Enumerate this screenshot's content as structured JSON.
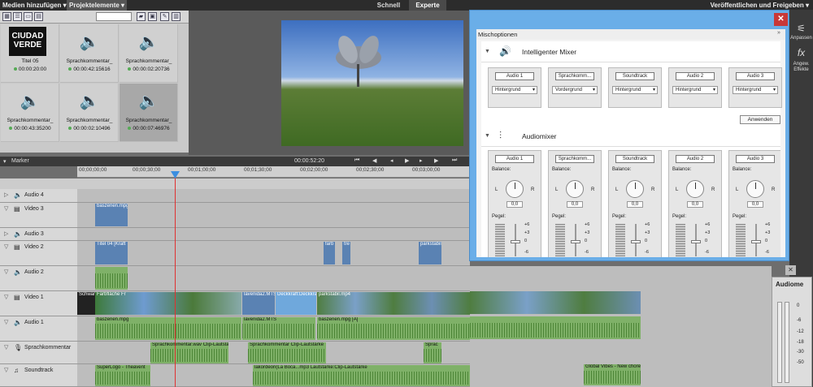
{
  "menu": {
    "media_add": "Medien hinzufügen ▾",
    "project_elements": "Projektelemente ▾",
    "mode_quick": "Schnell",
    "mode_expert": "Experte",
    "publish": "Veröffentlichen und Freigeben ▾"
  },
  "media_items": [
    {
      "name": "Titel 05",
      "duration": "00:00:20:00",
      "logo_line1": "CIUDAD",
      "logo_line2": "VERDE"
    },
    {
      "name": "Sprachkommentar_",
      "duration": "00:00:42:15616"
    },
    {
      "name": "Sprachkommentar_",
      "duration": "00:00:02:20736"
    },
    {
      "name": "Sprachkommentar_",
      "duration": "00:00:43:35200"
    },
    {
      "name": "Sprachkommentar_",
      "duration": "00:00:02:10496"
    },
    {
      "name": "Sprachkommentar_",
      "duration": "00:00:07:46976"
    }
  ],
  "timeline": {
    "marker_label": "Marker",
    "current_time": "00:00:52:20",
    "ruler_ticks": [
      "00;00;00;00",
      "00;00;30;00",
      "00;01;00;00",
      "00;01;30;00",
      "00;02;00;00",
      "00;02;30;00",
      "00;03;00;00"
    ],
    "tracks": [
      {
        "name": "Audio 4",
        "icon": "speaker-icon"
      },
      {
        "name": "Video 3",
        "icon": "film-icon"
      },
      {
        "name": "Audio 3",
        "icon": "speaker-icon"
      },
      {
        "name": "Video 2",
        "icon": "film-icon"
      },
      {
        "name": "Audio 2",
        "icon": "speaker-icon"
      },
      {
        "name": "Video 1",
        "icon": "film-icon"
      },
      {
        "name": "Audio 1",
        "icon": "speaker-icon"
      },
      {
        "name": "Sprachkommentar",
        "icon": "microphone-icon"
      },
      {
        "name": "Soundtrack",
        "icon": "music-icon"
      }
    ],
    "clips": {
      "video3": "baszenen.mpg",
      "video2_a": "Titel 04 [Kraft",
      "video2_b": "farb",
      "video2_c": "tre",
      "video2_d": "parkstabil",
      "video1_a": "Schwarz",
      "video1_b": "Farbfläche Fr",
      "video1_c": "lavenida2.MTS",
      "video1_d": "Deckkraft:Deckkraft",
      "video1_e": "parkstabil.mp4",
      "audio1_a": "baszenen.mpg",
      "audio1_b": "lavenida2.MTS",
      "audio1_c": "baszenen.mpg [A]",
      "sprach_a": "Sprachkommentar.wav Clip-Lautstärke",
      "sprach_b": "Sprachkommentar Clip-Lautstärke",
      "sprach_c": "Sprac",
      "sound_a": "SuperLogo - Theavent",
      "sound_b": "lakordeon(La Boca...mp3 Lautstärke:Clip-Lautstärke",
      "sound_c": "Global Vibes - New chores"
    }
  },
  "dialog": {
    "title": "Mischoptionen",
    "smart_mixer": "Intelligenter Mixer",
    "audio_mixer": "Audiomixer",
    "apply": "Anwenden",
    "balance_label": "Balance:",
    "level_label": "Pegel:",
    "left": "L",
    "right": "R",
    "balance_value": "0,0",
    "smart_channels": [
      {
        "name": "Audio 1",
        "mode": "Hintergrund"
      },
      {
        "name": "Sprachkomm...",
        "mode": "Vordergrund"
      },
      {
        "name": "Soundtrack",
        "mode": "Hintergrund"
      },
      {
        "name": "Audio 2",
        "mode": "Hintergrund"
      },
      {
        "name": "Audio 3",
        "mode": "Hintergrund"
      }
    ],
    "mixer_channels": [
      "Audio 1",
      "Sprachkomm...",
      "Soundtrack",
      "Audio 2",
      "Audio 3"
    ],
    "scale": [
      "+6",
      "+3",
      "0",
      "-6"
    ]
  },
  "right_panel": {
    "adjust": "Anpassen",
    "fx": "fx",
    "effects": "Angew. Effekte",
    "audiometer_title": "Audiome",
    "db_scale": [
      "0",
      "-6",
      "-12",
      "-18",
      "-30",
      "-50"
    ]
  }
}
